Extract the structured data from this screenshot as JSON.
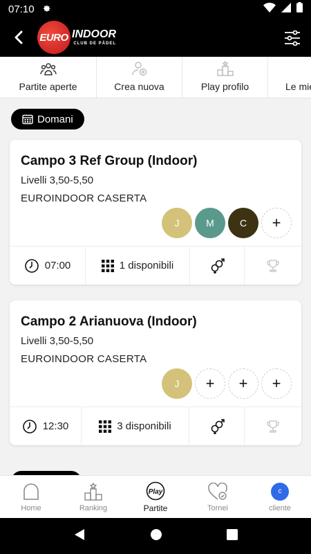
{
  "status_bar": {
    "time": "07:10"
  },
  "app_bar": {
    "logo_ball": "EURO",
    "logo_main": "INDOOR",
    "logo_sub": "CLUB DE PÁDEL"
  },
  "tabs": [
    {
      "label": "Partite aperte",
      "icon": "group-icon"
    },
    {
      "label": "Crea nuova",
      "icon": "add-user-icon"
    },
    {
      "label": "Play profilo",
      "icon": "podium-icon"
    },
    {
      "label": "Le mie",
      "icon": "partial-icon"
    }
  ],
  "date_chip": {
    "label": "Domani",
    "icon": "calendar-icon"
  },
  "matches": [
    {
      "title": "Campo 3 Ref Group (Indoor)",
      "levels": "Livelli 3,50-5,50",
      "club": "EUROINDOOR CASERTA",
      "players": [
        {
          "initial": "J",
          "color": "#d4c27a"
        },
        {
          "initial": "M",
          "color": "#5a9a8c"
        },
        {
          "initial": "C",
          "color": "#3d3212"
        }
      ],
      "empty_slot": "+",
      "time": "07:00",
      "availability": "1 disponibili"
    },
    {
      "title": "Campo 2 Arianuova (Indoor)",
      "levels": "Livelli 3,50-5,50",
      "club": "EUROINDOOR CASERTA",
      "players": [
        {
          "initial": "J",
          "color": "#d4c27a"
        }
      ],
      "empty_slot": "+",
      "time": "12:30",
      "availability": "3 disponibili"
    }
  ],
  "bottom_nav": [
    {
      "label": "Home",
      "icon": "home-icon"
    },
    {
      "label": "Ranking",
      "icon": "ranking-icon"
    },
    {
      "label": "Partite",
      "icon": "play-icon",
      "active": true
    },
    {
      "label": "Tornei",
      "icon": "heart-check-icon"
    },
    {
      "label": "cliente",
      "icon": "user-avatar",
      "avatar_initial": "c"
    }
  ],
  "colors": {
    "accent_red": "#d7261e",
    "user_blue": "#2f6be8"
  }
}
